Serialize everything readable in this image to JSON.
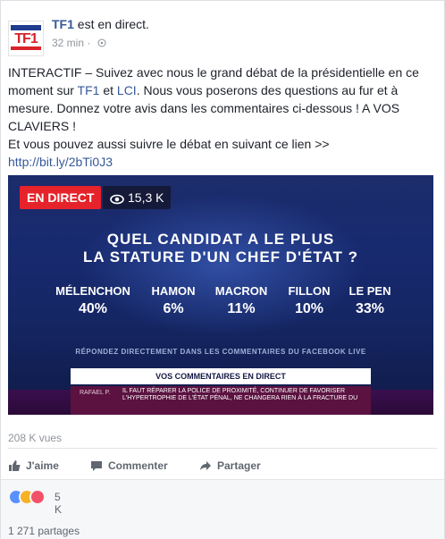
{
  "post": {
    "page_name": "TF1",
    "status": "est en direct.",
    "time": "32 min",
    "logo_text": "TF1",
    "text_intro": "INTERACTIF – Suivez avec nous le grand débat de la présidentielle en ce moment sur ",
    "link_tf1": "TF1",
    "text_et": " et ",
    "link_lci": "LCI",
    "text_rest": ". Nous vous poserons des questions au fur et à mesure. Donnez votre avis dans les commentaires ci-dessous ! A VOS CLAVIERS !",
    "text_line2": "Et vous pouvez aussi suivre le débat en suivant ce lien >> ",
    "link_url": "http://bit.ly/2bTi0J3"
  },
  "video": {
    "live_badge": "EN DIRECT",
    "viewers": "15,3 K",
    "question_line1": "QUEL CANDIDAT A LE PLUS",
    "question_line2": "LA STATURE D'UN CHEF D'ÉTAT ?",
    "candidates": [
      {
        "name": "MÉLENCHON",
        "value": "40%"
      },
      {
        "name": "HAMON",
        "value": "6%"
      },
      {
        "name": "MACRON",
        "value": "11%"
      },
      {
        "name": "FILLON",
        "value": "10%"
      },
      {
        "name": "LE PEN",
        "value": "33%"
      }
    ],
    "respond_text": "RÉPONDEZ DIRECTEMENT DANS LES COMMENTAIRES DU FACEBOOK LIVE",
    "comments_header": "VOS COMMENTAIRES EN DIRECT",
    "ticker_author": "RAFAEL P.",
    "ticker_text": "IL FAUT RÉPARER LA POLICE DE PROXIMITÉ, CONTINUER DE FAVORISER L'HYPERTROPHIE DE L'ÉTAT PÉNAL, NE CHANGERA RIEN À LA FRACTURE DU"
  },
  "stats": {
    "views": "208 K vues",
    "reactions_count": "5 K",
    "shares": "1 271 partages"
  },
  "actions": {
    "like": "J'aime",
    "comment": "Commenter",
    "share": "Partager"
  },
  "colors": {
    "link": "#365899",
    "live_red": "#e6222a",
    "like_blue": "#5890ff",
    "love_red": "#f25268",
    "angry_orange": "#f7b125"
  }
}
